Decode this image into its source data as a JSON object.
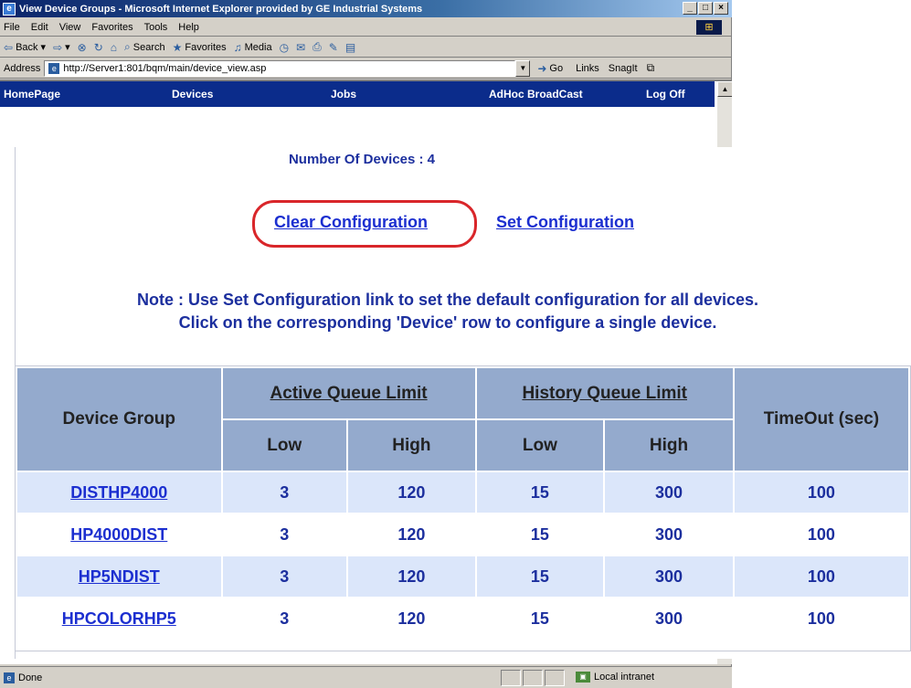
{
  "window": {
    "title": "View Device Groups - Microsoft Internet Explorer provided by GE Industrial Systems",
    "buttons": [
      "_",
      "□",
      "×"
    ]
  },
  "menubar": {
    "items": [
      "File",
      "Edit",
      "View",
      "Favorites",
      "Tools",
      "Help"
    ]
  },
  "toolbar": {
    "back": "Back",
    "search": "Search",
    "favorites": "Favorites",
    "media": "Media"
  },
  "addressbar": {
    "label": "Address",
    "url": "http://Server1:801/bqm/main/device_view.asp",
    "go": "Go",
    "links": "Links",
    "snagit": "SnagIt"
  },
  "nav": {
    "items": [
      "HomePage",
      "Devices",
      "Jobs",
      "AdHoc BroadCast",
      "Log Off"
    ]
  },
  "page": {
    "device_count": "Number Of Devices : 4",
    "clear_config": "Clear Configuration",
    "set_config": "Set Configuration",
    "note_line1": "Note : Use Set Configuration link to set the default configuration for all devices.",
    "note_line2": "Click on the corresponding 'Device' row to configure a single device."
  },
  "table": {
    "headers": {
      "device_group": "Device Group",
      "active_queue": "Active Queue Limit",
      "history_queue": "History Queue Limit",
      "timeout": "TimeOut (sec)",
      "low": "Low",
      "high": "High"
    },
    "rows": [
      {
        "group": "DISTHP4000",
        "active_low": "3",
        "active_high": "120",
        "history_low": "15",
        "history_high": "300",
        "timeout": "100"
      },
      {
        "group": "HP4000DIST",
        "active_low": "3",
        "active_high": "120",
        "history_low": "15",
        "history_high": "300",
        "timeout": "100"
      },
      {
        "group": "HP5NDIST",
        "active_low": "3",
        "active_high": "120",
        "history_low": "15",
        "history_high": "300",
        "timeout": "100"
      },
      {
        "group": "HPCOLORHP5",
        "active_low": "3",
        "active_high": "120",
        "history_low": "15",
        "history_high": "300",
        "timeout": "100"
      }
    ]
  },
  "statusbar": {
    "text": "Done",
    "zone": "Local intranet"
  },
  "colors": {
    "nav_bg": "#0b2c8b",
    "header_bg": "#94aacd",
    "row_alt": "#dbe6fa",
    "link": "#1c2fd0",
    "highlight": "#d9262a"
  }
}
